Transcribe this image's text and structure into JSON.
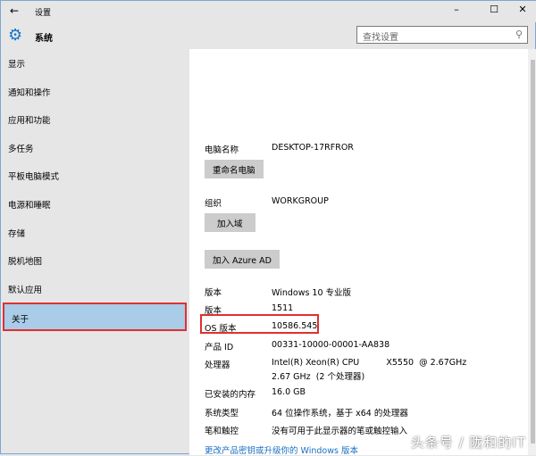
{
  "window": {
    "title": "设置",
    "minimize": "–",
    "maximize": "☐",
    "close": "✕",
    "back": "←"
  },
  "header": {
    "title": "系统",
    "search_placeholder": "查找设置"
  },
  "sidebar": {
    "items": [
      {
        "label": "显示"
      },
      {
        "label": "通知和操作"
      },
      {
        "label": "应用和功能"
      },
      {
        "label": "多任务"
      },
      {
        "label": "平板电脑模式"
      },
      {
        "label": "电源和睡眠"
      },
      {
        "label": "存储"
      },
      {
        "label": "脱机地图"
      },
      {
        "label": "默认应用"
      },
      {
        "label": "关于",
        "selected": true
      }
    ]
  },
  "about": {
    "pc_name_label": "电脑名称",
    "pc_name": "DESKTOP-17RFROR",
    "rename_button": "重命名电脑",
    "org_label": "组织",
    "org": "WORKGROUP",
    "join_domain_button": "加入域",
    "join_azure_button": "加入 Azure AD",
    "specs": [
      {
        "label": "版本",
        "value": "Windows 10 专业版"
      },
      {
        "label": "版本",
        "value": "1511"
      },
      {
        "label": "OS 版本",
        "value": "10586.545"
      },
      {
        "label": "产品 ID",
        "value": "00331-10000-00001-AA838"
      },
      {
        "label": "处理器",
        "value": "Intel(R) Xeon(R) CPU          X5550  @ 2.67GHz",
        "value2": "2.67 GHz  (2 个处理器)"
      },
      {
        "label": "已安装的内存",
        "value": "16.0 GB"
      },
      {
        "label": "系统类型",
        "value": "64 位操作系统，基于 x64 的处理器"
      },
      {
        "label": "笔和触控",
        "value": "没有可用于此显示器的笔或触控输入"
      }
    ],
    "upgrade_link": "更改产品密钥或升级你的 Windows 版本"
  },
  "watermark": "头条号 / 陇和的IT"
}
